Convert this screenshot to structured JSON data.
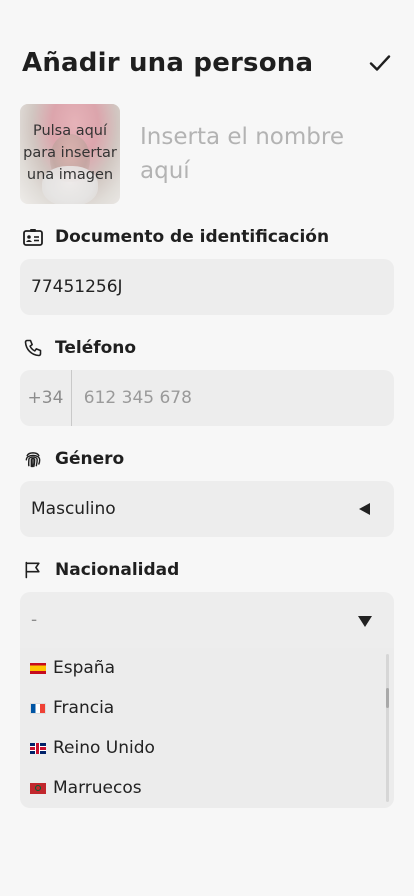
{
  "header": {
    "title": "Añadir una persona",
    "confirm_icon": "check-icon"
  },
  "photo": {
    "hint": "Pulsa aquí\npara insertar\nuna imagen"
  },
  "name": {
    "placeholder": "Inserta el nombre aquí"
  },
  "document": {
    "label": "Documento de identificación",
    "icon": "id-card-icon",
    "value": "77451256J"
  },
  "phone": {
    "label": "Teléfono",
    "icon": "phone-icon",
    "prefix": "+34",
    "placeholder": "612 345 678"
  },
  "gender": {
    "label": "Género",
    "icon": "fingerprint-icon",
    "value": "Masculino"
  },
  "nationality": {
    "label": "Nacionalidad",
    "icon": "flag-icon",
    "value": "-",
    "options": [
      {
        "label": "España",
        "flag": "es"
      },
      {
        "label": "Francia",
        "flag": "fr"
      },
      {
        "label": "Reino Unido",
        "flag": "gb"
      },
      {
        "label": "Marruecos",
        "flag": "ma"
      }
    ]
  }
}
